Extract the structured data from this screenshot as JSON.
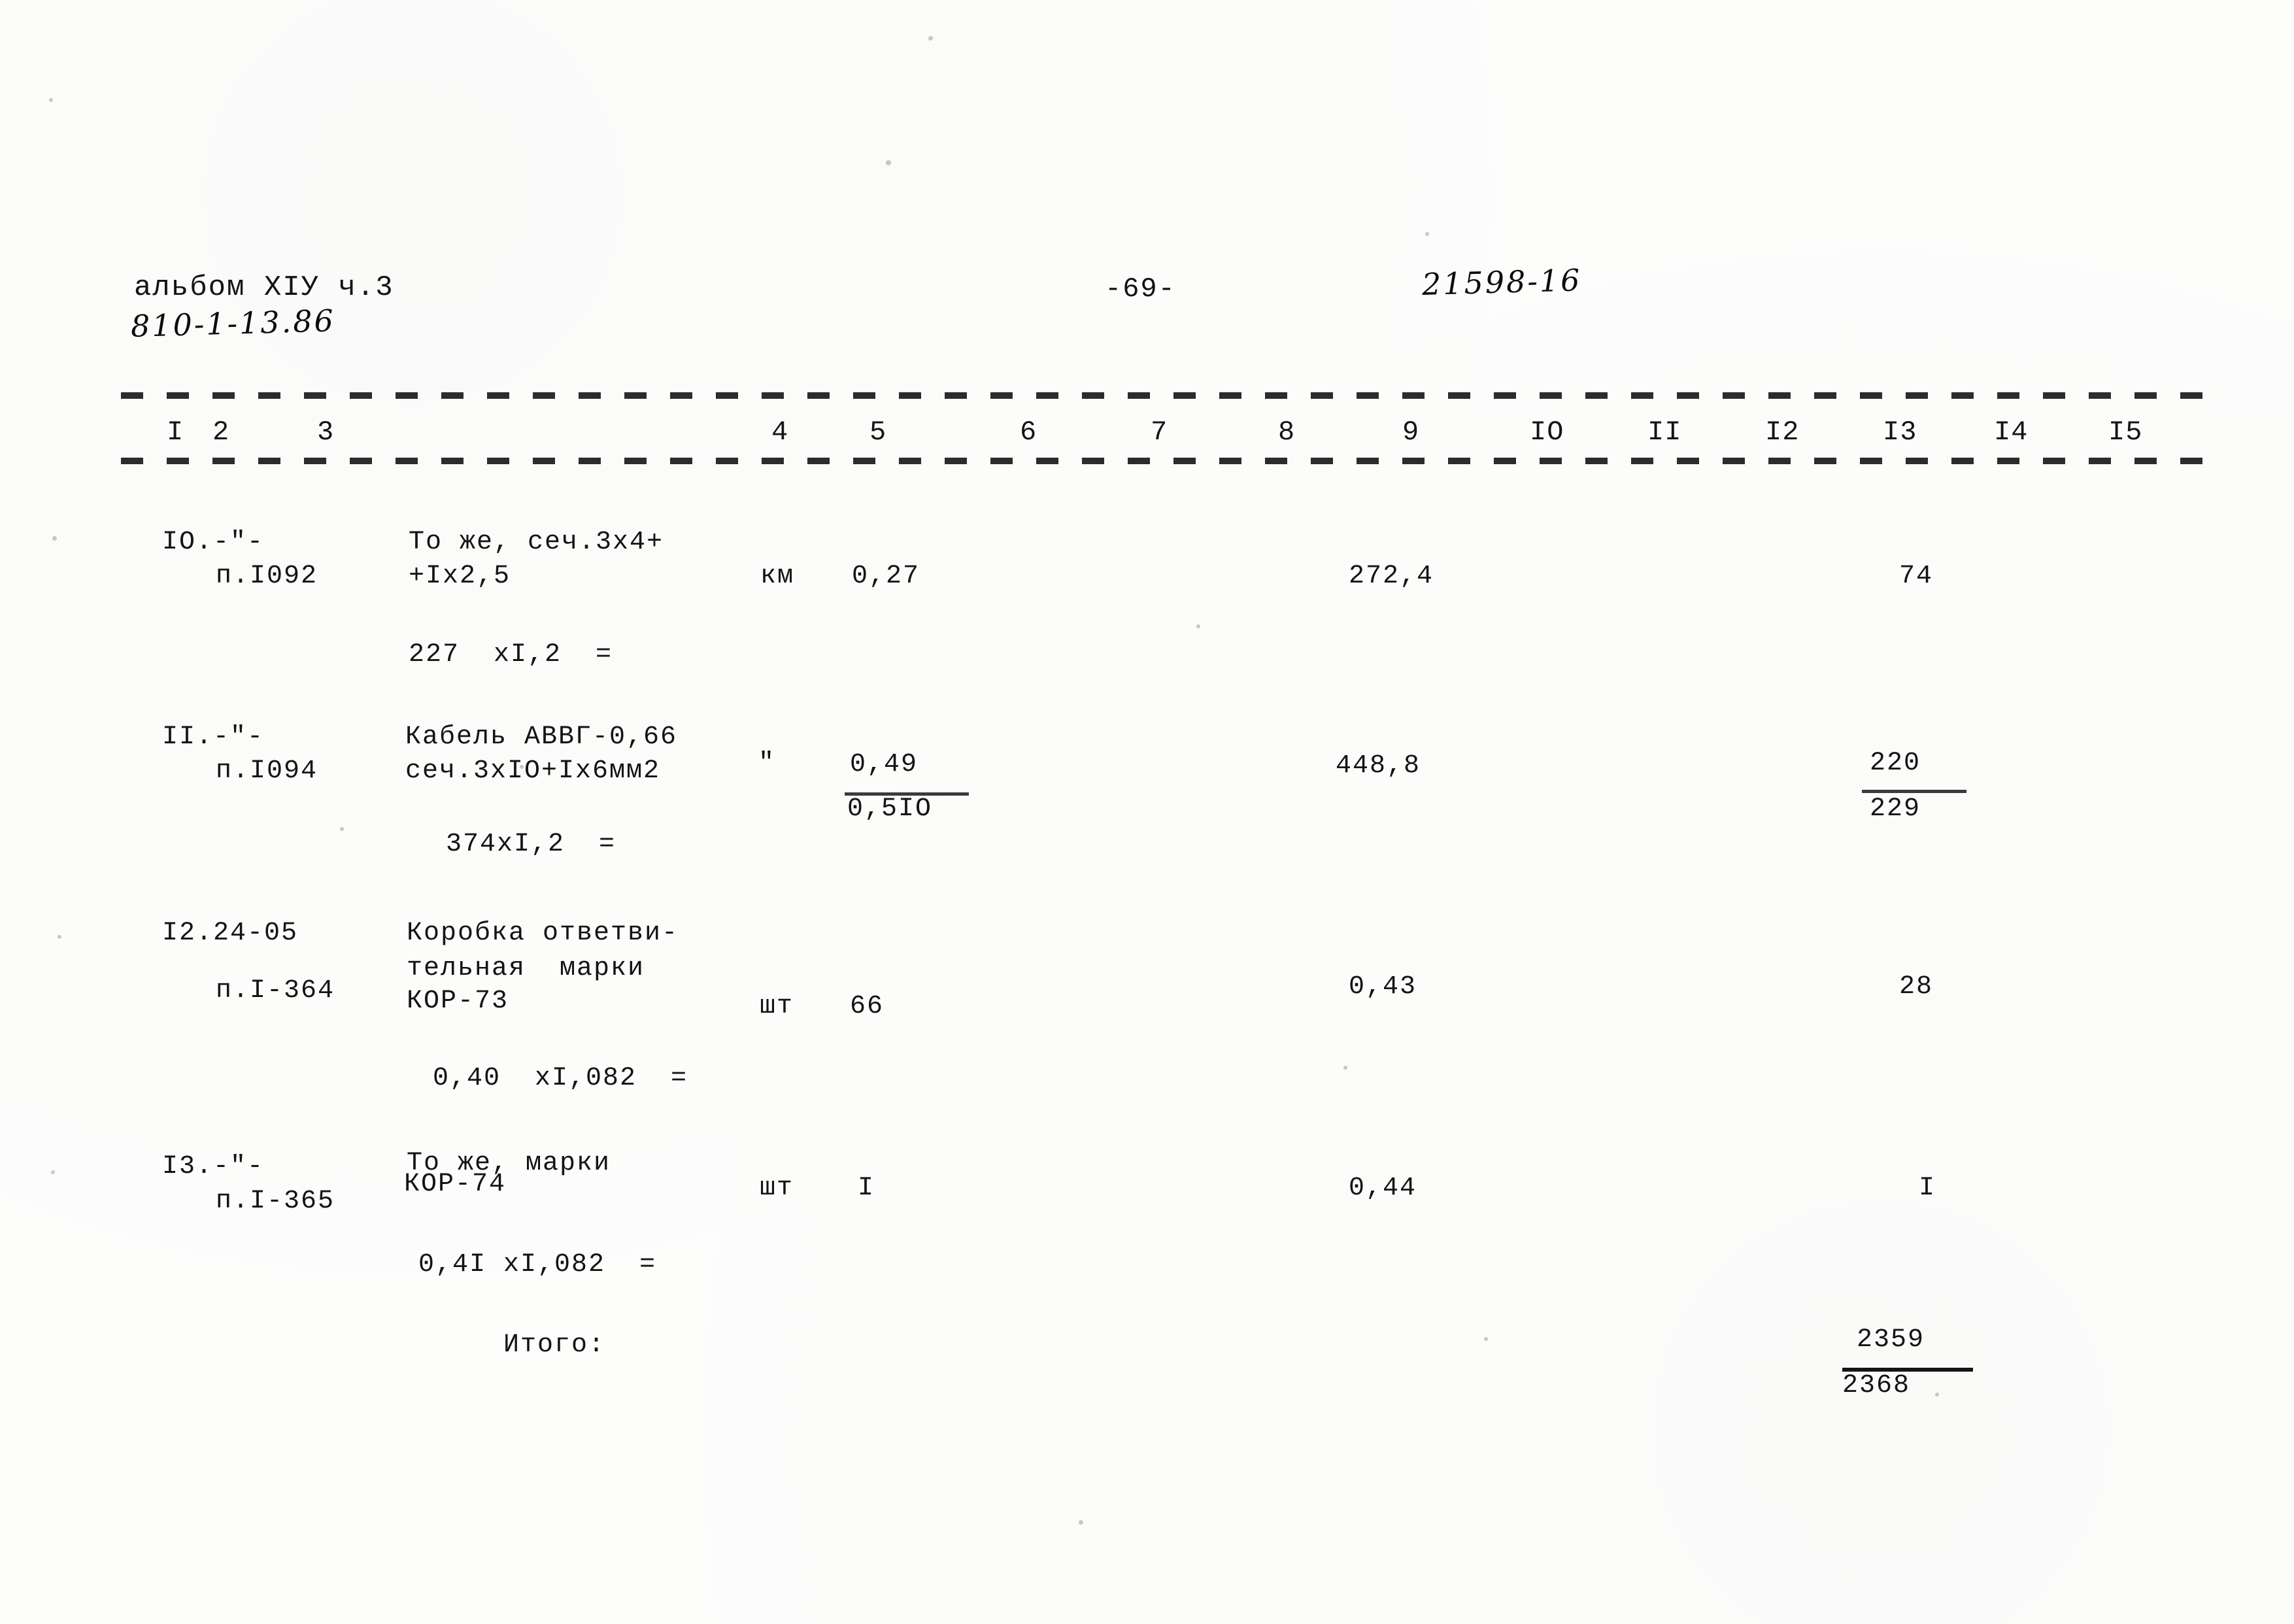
{
  "document": {
    "album_label": "альбом ХIУ ч.3",
    "handwritten_code": "810-1-13.86",
    "page_number": "-69-",
    "handwritten_ref": "21598-16"
  },
  "table": {
    "column_headers": [
      "I",
      "2",
      "3",
      "4",
      "5",
      "6",
      "7",
      "8",
      "9",
      "IO",
      "II",
      "I2",
      "I3",
      "I4",
      "I5"
    ],
    "rows": [
      {
        "num": "IO.-\"-",
        "code": "п.I092",
        "desc_line1": "То же, сеч.3х4+",
        "desc_line2": "+Iх2,5",
        "calc": "227  хI,2  =",
        "unit": "км",
        "qty": "0,27",
        "col9": "272,4",
        "col13": "74",
        "col13_under": "",
        "qty_under": ""
      },
      {
        "num": "II.-\"-",
        "code": "п.I094",
        "desc_line1": "Кабель АВВГ-0,66",
        "desc_line2": "сеч.3хIО+Iх6мм2",
        "calc": "374хI,2  =",
        "unit": "\"",
        "qty": "0,49",
        "qty_under": "0,5IО",
        "col9": "448,8",
        "col13": "220",
        "col13_under": "229"
      },
      {
        "num": "I2.24-05",
        "code": "п.I-364",
        "desc_line1": "Коробка ответви-",
        "desc_line2": "тельная  марки",
        "desc_line3": "КОР-73",
        "calc": "0,40  хI,082  =",
        "unit": "шт",
        "qty": "66",
        "col9": "0,43",
        "col13": "28",
        "col13_under": "",
        "qty_under": ""
      },
      {
        "num": "I3.-\"-",
        "code": "п.I-365",
        "desc_line1": "То же, марки",
        "desc_line2": "КОР-74",
        "calc": "0,4I хI,082  =",
        "unit": "шт",
        "qty": "I",
        "col9": "0,44",
        "col13": "I",
        "col13_under": "",
        "qty_under": ""
      }
    ],
    "total": {
      "label": "Итого:",
      "value": "2359",
      "value_under": "2368"
    }
  }
}
